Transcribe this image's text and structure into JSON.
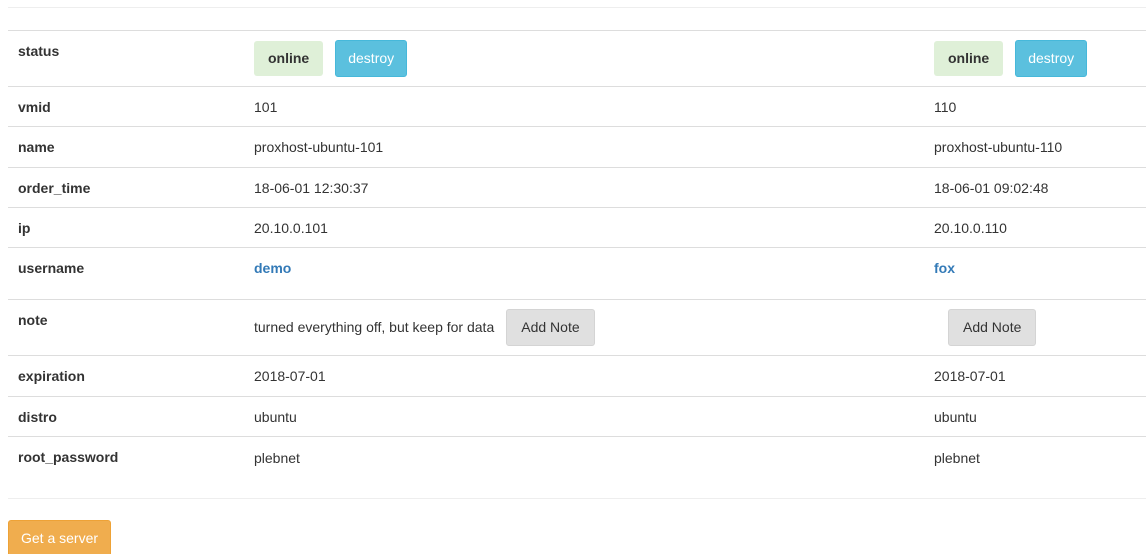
{
  "rows": {
    "status": "status",
    "vmid": "vmid",
    "name": "name",
    "order_time": "order_time",
    "ip": "ip",
    "username": "username",
    "note": "note",
    "expiration": "expiration",
    "distro": "distro",
    "root_password": "root_password"
  },
  "servers": [
    {
      "status": "online",
      "destroy_label": "destroy",
      "vmid": "101",
      "name": "proxhost-ubuntu-101",
      "order_time": "18-06-01 12:30:37",
      "ip": "20.10.0.101",
      "username": "demo",
      "note": "turned everything off, but keep for data",
      "add_note_label": "Add Note",
      "expiration": "2018-07-01",
      "distro": "ubuntu",
      "root_password": "plebnet"
    },
    {
      "status": "online",
      "destroy_label": "destroy",
      "vmid": "110",
      "name": "proxhost-ubuntu-110",
      "order_time": "18-06-01 09:02:48",
      "ip": "20.10.0.110",
      "username": "fox",
      "note": "",
      "add_note_label": "Add Note",
      "expiration": "2018-07-01",
      "distro": "ubuntu",
      "root_password": "plebnet"
    }
  ],
  "get_server_label": "Get a server",
  "colors": {
    "online_bg": "#dff0d8",
    "destroy_bg": "#5bc0de",
    "link": "#337ab7",
    "get_server_bg": "#f0ad4e",
    "note_button_bg": "#e0e0e0"
  }
}
